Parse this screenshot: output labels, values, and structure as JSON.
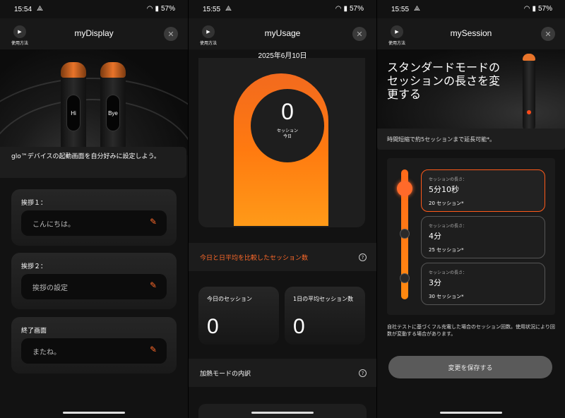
{
  "status": [
    {
      "time": "15:54",
      "battery": "57%"
    },
    {
      "time": "15:55",
      "battery": "57%"
    },
    {
      "time": "15:55",
      "battery": "57%"
    }
  ],
  "common": {
    "howto_label": "使用方法",
    "close_symbol": "✕",
    "play_symbol": "▶",
    "howto_icon": "play-icon",
    "close_icon": "close-icon",
    "accent_color": "#ff6a2a"
  },
  "display": {
    "title": "myDisplay",
    "device_left_text": "Hi",
    "device_right_text": "Bye",
    "intro": "glo™デバイスの起動画面を自分好みに設定しよう。",
    "cards": [
      {
        "label": "挨拶１：",
        "value": "こんにちは。"
      },
      {
        "label": "挨拶２：",
        "value": "挨拶の設定"
      },
      {
        "label": "終了画面",
        "value": "またね。"
      }
    ],
    "edit_icon": "pencil-icon"
  },
  "usage": {
    "title": "myUsage",
    "date": "2025年6月10日",
    "gauge_value": "0",
    "gauge_label_line1": "セッション",
    "gauge_label_line2": "今日",
    "compare_title": "今日と日平均を比較したセッション数",
    "today_label": "今日のセッション",
    "today_value": "0",
    "avg_label": "1日の平均セッション数",
    "avg_value": "0",
    "breakdown_title": "加熱モードの内訳",
    "help_icon": "question-icon"
  },
  "session": {
    "title": "mySession",
    "hero_title": "スタンダードモードの セッションの長さを変更する",
    "extend_text": "時間短縮で約5セッションまで延長可能*。",
    "options": [
      {
        "label": "セッションの長さ：",
        "duration": "5分10秒",
        "count": "20 セッション*"
      },
      {
        "label": "セッションの長さ：",
        "duration": "4分",
        "count": "25 セッション*"
      },
      {
        "label": "セッションの長さ：",
        "duration": "3分",
        "count": "30 セッション*"
      }
    ],
    "selected_index": 0,
    "footnote": "自社テストに基づくフル充電した場合のセッション回数。使用状況により回数が変動する場合があります。",
    "save_label": "変更を保存する"
  }
}
